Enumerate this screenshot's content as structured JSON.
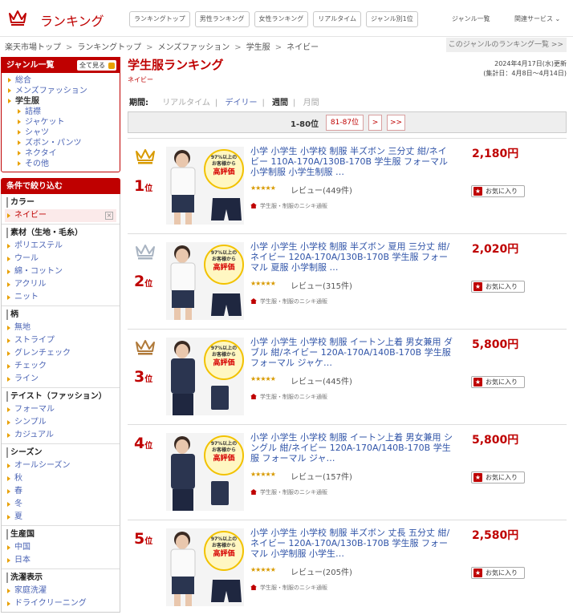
{
  "header": {
    "logo_text": "ランキング",
    "tabs": [
      "ランキングトップ",
      "男性ランキング",
      "女性ランキング",
      "リアルタイム",
      "ジャンル別1位"
    ],
    "genre_list_link": "ジャンル一覧",
    "related_link": "関連サービス"
  },
  "breadcrumb": [
    "楽天市場トップ",
    "ランキングトップ",
    "メンズファッション",
    "学生服",
    "ネイビー"
  ],
  "genre_ranking_button": "このジャンルのランキング一覧 >>",
  "sidebar": {
    "genre_title": "ジャンル一覧",
    "all_button": "全て見る",
    "genres": [
      {
        "label": "総合",
        "level": 0,
        "current": false
      },
      {
        "label": "メンズファッション",
        "level": 0,
        "current": false
      },
      {
        "label": "学生服",
        "level": 0,
        "current": true
      },
      {
        "label": "詰襟",
        "level": 1,
        "current": false
      },
      {
        "label": "ジャケット",
        "level": 1,
        "current": false
      },
      {
        "label": "シャツ",
        "level": 1,
        "current": false
      },
      {
        "label": "ズボン・パンツ",
        "level": 1,
        "current": false
      },
      {
        "label": "ネクタイ",
        "level": 1,
        "current": false
      },
      {
        "label": "その他",
        "level": 1,
        "current": false
      }
    ],
    "filter_title": "条件で絞り込む",
    "filters": [
      {
        "title": "カラー",
        "items": [
          "ネイビー"
        ],
        "selected": "ネイビー"
      },
      {
        "title": "素材（生地・毛糸）",
        "items": [
          "ポリエステル",
          "ウール",
          "綿・コットン",
          "アクリル",
          "ニット"
        ]
      },
      {
        "title": "柄",
        "items": [
          "無地",
          "ストライプ",
          "グレンチェック",
          "チェック",
          "ライン"
        ]
      },
      {
        "title": "テイスト（ファッション）",
        "items": [
          "フォーマル",
          "シンプル",
          "カジュアル"
        ]
      },
      {
        "title": "シーズン",
        "items": [
          "オールシーズン",
          "秋",
          "春",
          "冬",
          "夏"
        ]
      },
      {
        "title": "生産国",
        "items": [
          "中国",
          "日本"
        ]
      },
      {
        "title": "洗濯表示",
        "items": [
          "家庭洗濯",
          "ドライクリーニング"
        ]
      }
    ]
  },
  "main": {
    "title": "学生服ランキング",
    "subtitle": "ネイビー",
    "updated": "2024年4月17日(水)更新",
    "period_range": "(集計日：4月8日〜4月14日)",
    "period_label": "期間:",
    "periods": [
      "リアルタイム",
      "デイリー",
      "週間",
      "月間"
    ],
    "active_period": "週間",
    "pager": {
      "current": "1-80位",
      "next": "81-87位",
      "next_btn": ">",
      "last_btn": ">>"
    }
  },
  "thumb_texts": {
    "line1": "97%以上の",
    "line2": "お客様から",
    "line3": "高評価"
  },
  "items": [
    {
      "rank": "1",
      "rank_suffix": "位",
      "crown": "gold",
      "name": "小学 小学生 小学校 制服 半ズボン 三分丈 紺/ネイビー 110A-170A/130B-170B 学生服 フォーマル 小学制服 小学生制服 …",
      "stars": "★★★★★",
      "reviews": "レビュー(449件)",
      "shop": "学生服・制服のニシキ通販",
      "price": "2,180円",
      "fav": "お気に入り",
      "thumb_type": "shorts"
    },
    {
      "rank": "2",
      "rank_suffix": "位",
      "crown": "silver",
      "name": "小学 小学生 小学校 制服 半ズボン 夏用 三分丈 紺/ネイビー 120A-170A/130B-170B 学生服 フォーマル 夏服 小学制服 …",
      "stars": "★★★★★",
      "reviews": "レビュー(315件)",
      "shop": "学生服・制服のニシキ通販",
      "price": "2,020円",
      "fav": "お気に入り",
      "thumb_type": "shorts"
    },
    {
      "rank": "3",
      "rank_suffix": "位",
      "crown": "bronze",
      "name": "小学 小学生 小学校 制服 イートン上着 男女兼用 ダブル 紺/ネイビー 120A-170A/140B-170B 学生服 フォーマル ジャケ…",
      "stars": "★★★★★",
      "reviews": "レビュー(445件)",
      "shop": "学生服・制服のニシキ通販",
      "price": "5,800円",
      "fav": "お気に入り",
      "thumb_type": "jacket"
    },
    {
      "rank": "4",
      "rank_suffix": "位",
      "crown": "",
      "name": "小学 小学生 小学校 制服 イートン上着 男女兼用 シングル 紺/ネイビー 120A-170A/140B-170B 学生服 フォーマル ジャ…",
      "stars": "★★★★★",
      "reviews": "レビュー(157件)",
      "shop": "学生服・制服のニシキ通販",
      "price": "5,800円",
      "fav": "お気に入り",
      "thumb_type": "jacket"
    },
    {
      "rank": "5",
      "rank_suffix": "位",
      "crown": "",
      "name": "小学 小学生 小学校 制服 半ズボン 丈長 五分丈 紺/ネイビー 120A-170A/130B-170B 学生服 フォーマル 小学制服 小学生…",
      "stars": "★★★★★",
      "reviews": "レビュー(205件)",
      "shop": "学生服・制服のニシキ通販",
      "price": "2,580円",
      "fav": "お気に入り",
      "thumb_type": "shorts"
    }
  ],
  "colors": {
    "brand": "#bf0000",
    "gold": "#d89a00",
    "silver": "#a9b4c2",
    "bronze": "#b07a3a",
    "link": "#3054a8"
  }
}
